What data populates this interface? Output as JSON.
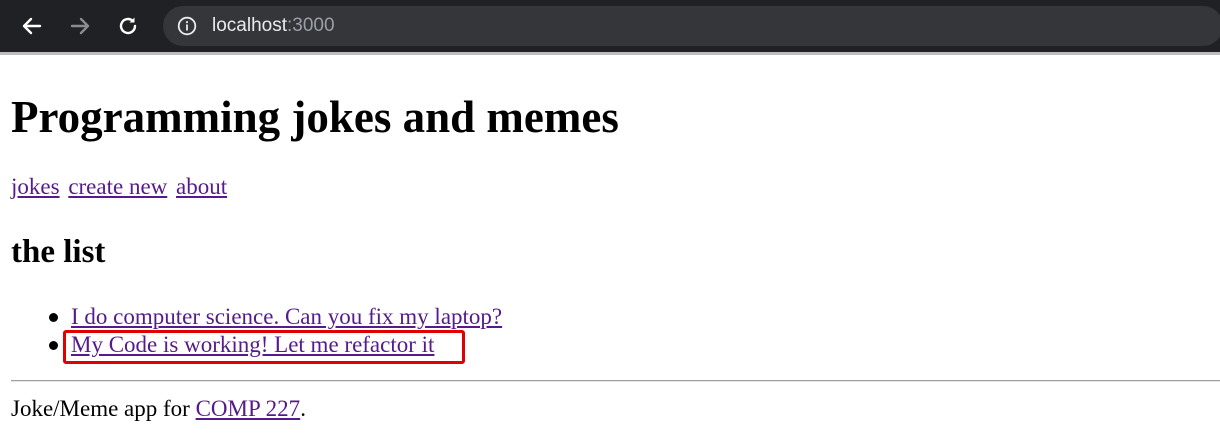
{
  "browser": {
    "url_host": "localhost",
    "url_port": ":3000",
    "back_icon": "arrow-left-icon",
    "forward_icon": "arrow-right-icon",
    "reload_icon": "reload-icon",
    "info_icon": "info-icon"
  },
  "page": {
    "title": "Programming jokes and memes",
    "nav": [
      {
        "label": "jokes"
      },
      {
        "label": "create new"
      },
      {
        "label": "about"
      }
    ],
    "section_title": "the list",
    "jokes": [
      {
        "label": "I do computer science. Can you fix my laptop?"
      },
      {
        "label": "My Code is working! Let me refactor it"
      }
    ],
    "footer": {
      "prefix": "Joke/Meme app for ",
      "link": "COMP 227",
      "suffix": "."
    }
  },
  "colors": {
    "link": "#551a8b",
    "highlight": "#e00000",
    "browser_bar": "#202124",
    "omnibox": "#35363a"
  }
}
